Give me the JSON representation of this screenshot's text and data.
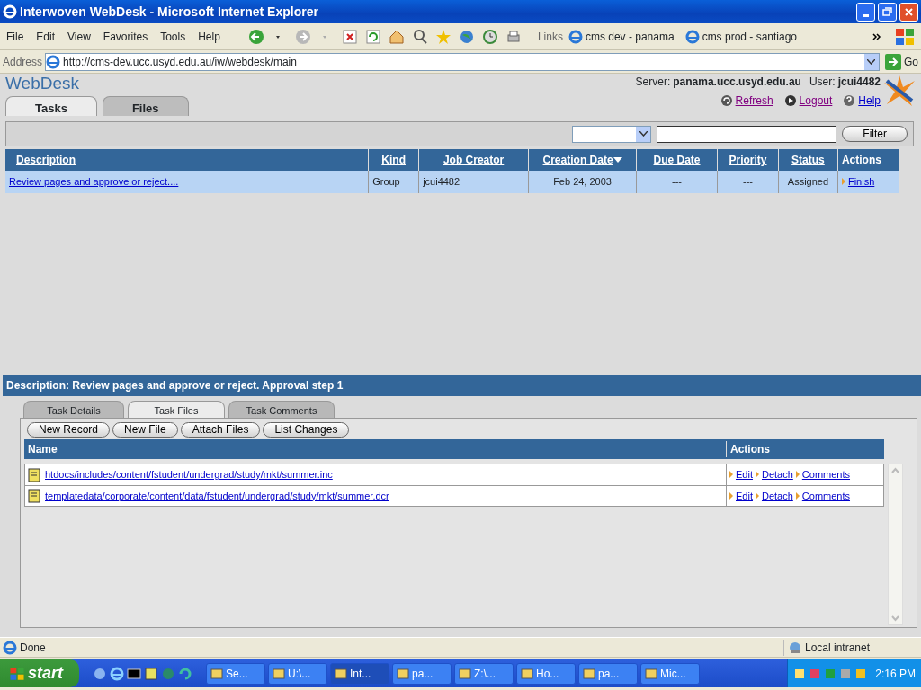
{
  "window": {
    "title": "Interwoven WebDesk - Microsoft Internet Explorer"
  },
  "menu": [
    "File",
    "Edit",
    "View",
    "Favorites",
    "Tools",
    "Help"
  ],
  "links_bar": {
    "label": "Links",
    "items": [
      "cms dev - panama",
      "cms prod - santiago"
    ]
  },
  "address_bar": {
    "label": "Address",
    "value": "http://cms-dev.ucc.usyd.edu.au/iw/webdesk/main",
    "go": "Go"
  },
  "app_header": {
    "logo": "WebDesk",
    "server_label": "Server:",
    "server": "panama.ucc.usyd.edu.au",
    "user_label": "User:",
    "user": "jcui4482",
    "links": [
      "Refresh",
      "Logout",
      "Help"
    ]
  },
  "main_tabs": [
    {
      "label": "Tasks",
      "selected": true
    },
    {
      "label": "Files",
      "selected": false
    }
  ],
  "filter": {
    "button": "Filter"
  },
  "task_table": {
    "columns": [
      {
        "label": "Description",
        "sorted": false
      },
      {
        "label": "Kind",
        "sorted": false
      },
      {
        "label": "Job Creator",
        "sorted": false
      },
      {
        "label": "Creation Date",
        "sorted": true
      },
      {
        "label": "Due Date",
        "sorted": false
      },
      {
        "label": "Priority",
        "sorted": false
      },
      {
        "label": "Status",
        "sorted": false
      },
      {
        "label": "Actions",
        "sorted": false
      }
    ],
    "rows": [
      {
        "selected": true,
        "description": "Review pages and approve or reject....",
        "kind": "Group",
        "job_creator": "jcui4482",
        "creation_date": "Feb 24, 2003",
        "due_date": "---",
        "priority": "---",
        "status": "Assigned",
        "action": "Finish"
      }
    ]
  },
  "description_bar": "Description: Review pages and approve or reject. Approval step 1",
  "detail_tabs": [
    {
      "label": "Task Details",
      "selected": false
    },
    {
      "label": "Task Files",
      "selected": true
    },
    {
      "label": "Task Comments",
      "selected": false
    }
  ],
  "file_buttons": [
    "New Record",
    "New File",
    "Attach Files",
    "List Changes"
  ],
  "files_table": {
    "columns": [
      "Name",
      "Actions"
    ],
    "rows": [
      {
        "name": "htdocs/includes/content/fstudent/undergrad/study/mkt/summer.inc",
        "actions": [
          "Edit",
          "Detach",
          "Comments"
        ]
      },
      {
        "name": "templatedata/corporate/content/data/fstudent/undergrad/study/mkt/summer.dcr",
        "actions": [
          "Edit",
          "Detach",
          "Comments"
        ]
      }
    ]
  },
  "status_bar": {
    "text": "Done",
    "zone": "Local intranet"
  },
  "taskbar": {
    "start": "start",
    "tasks": [
      {
        "label": "Se...",
        "selected": false
      },
      {
        "label": "U:\\...",
        "selected": false
      },
      {
        "label": "Int...",
        "selected": true
      },
      {
        "label": "pa...",
        "selected": false
      },
      {
        "label": "Z:\\...",
        "selected": false
      },
      {
        "label": "Ho...",
        "selected": false
      },
      {
        "label": "pa...",
        "selected": false
      },
      {
        "label": "Mic...",
        "selected": false
      }
    ],
    "clock": "2:16 PM"
  }
}
